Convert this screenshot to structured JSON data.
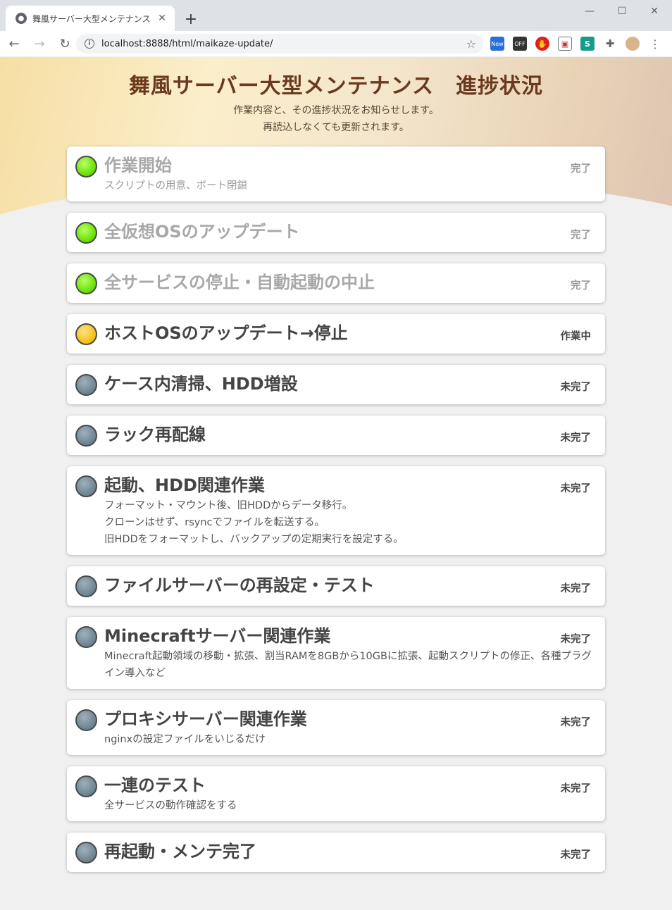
{
  "browser": {
    "tab_title": "舞風サーバー大型メンテナンス",
    "tab_close": "✕",
    "new_tab": "+",
    "url": "localhost:8888/html/maikaze-update/",
    "window_controls": {
      "minimize": "—",
      "maximize": "☐",
      "close": "✕"
    },
    "extensions": [
      {
        "name": "new-extension-icon",
        "label": "New"
      },
      {
        "name": "off-extension-icon",
        "label": "OFF"
      }
    ]
  },
  "header": {
    "title": "舞風サーバー大型メンテナンス　進捗状況",
    "subtitle_line1": "作業内容と、その進捗状況をお知らせします。",
    "subtitle_line2": "再読込しなくても更新されます。"
  },
  "colors": {
    "done": "#6fe30a",
    "in_progress": "#f7c21c",
    "todo": "#728896",
    "title": "#6b3a1e"
  },
  "tasks": [
    {
      "name": "作業開始",
      "desc": [
        "スクリプトの用意、ポート閉鎖"
      ],
      "status": "完了",
      "state": "done"
    },
    {
      "name": "全仮想OSのアップデート",
      "desc": [],
      "status": "完了",
      "state": "done"
    },
    {
      "name": "全サービスの停止・自動起動の中止",
      "desc": [],
      "status": "完了",
      "state": "done"
    },
    {
      "name": "ホストOSのアップデート→停止",
      "desc": [],
      "status": "作業中",
      "state": "progress"
    },
    {
      "name": "ケース内清掃、HDD増設",
      "desc": [],
      "status": "未完了",
      "state": "todo"
    },
    {
      "name": "ラック再配線",
      "desc": [],
      "status": "未完了",
      "state": "todo"
    },
    {
      "name": "起動、HDD関連作業",
      "desc": [
        "フォーマット・マウント後、旧HDDからデータ移行。",
        "クローンはせず、rsyncでファイルを転送する。",
        "旧HDDをフォーマットし、バックアップの定期実行を設定する。"
      ],
      "status": "未完了",
      "state": "todo"
    },
    {
      "name": "ファイルサーバーの再設定・テスト",
      "desc": [],
      "status": "未完了",
      "state": "todo"
    },
    {
      "name": "Minecraftサーバー関連作業",
      "desc": [
        "Minecraft起動領域の移動・拡張、割当RAMを8GBから10GBに拡張、起動スクリプトの修正、各種プラグイン導入など"
      ],
      "status": "未完了",
      "state": "todo",
      "wide": true
    },
    {
      "name": "プロキシサーバー関連作業",
      "desc": [
        "nginxの設定ファイルをいじるだけ"
      ],
      "status": "未完了",
      "state": "todo"
    },
    {
      "name": "一連のテスト",
      "desc": [
        "全サービスの動作確認をする"
      ],
      "status": "未完了",
      "state": "todo"
    },
    {
      "name": "再起動・メンテ完了",
      "desc": [],
      "status": "未完了",
      "state": "todo"
    }
  ]
}
